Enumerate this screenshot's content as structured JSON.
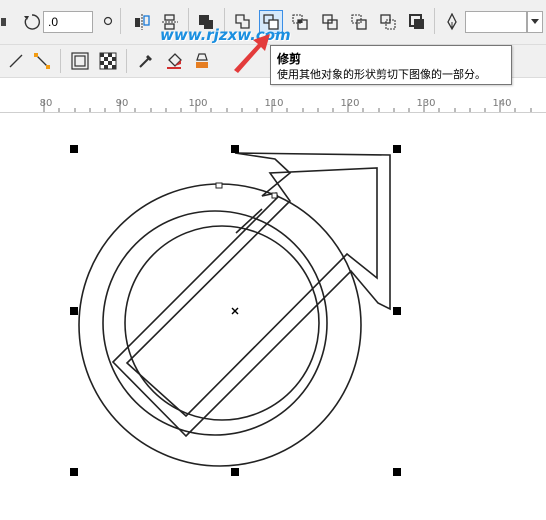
{
  "toolbar_top": {
    "rotation_value": ".0",
    "outline_width_value": "",
    "buttons": [
      {
        "name": "weld-icon"
      },
      {
        "name": "trim-icon"
      },
      {
        "name": "intersect-icon"
      },
      {
        "name": "simplify-icon"
      },
      {
        "name": "front-minus-back-icon"
      },
      {
        "name": "back-minus-front-icon"
      },
      {
        "name": "create-boundary-icon"
      }
    ]
  },
  "watermark": "www.rjzxw.com",
  "tooltip": {
    "title": "修剪",
    "description": "使用其他对象的形状剪切下图像的一部分。"
  },
  "ruler": {
    "labels": [
      "80",
      "90",
      "100",
      "110",
      "120",
      "130",
      "140"
    ]
  },
  "colors": {
    "toolbar_bg": "#f0f0f0",
    "active_button_border": "#3a8ee6",
    "watermark": "#1a8fe0",
    "arrow": "#e33b3b"
  }
}
